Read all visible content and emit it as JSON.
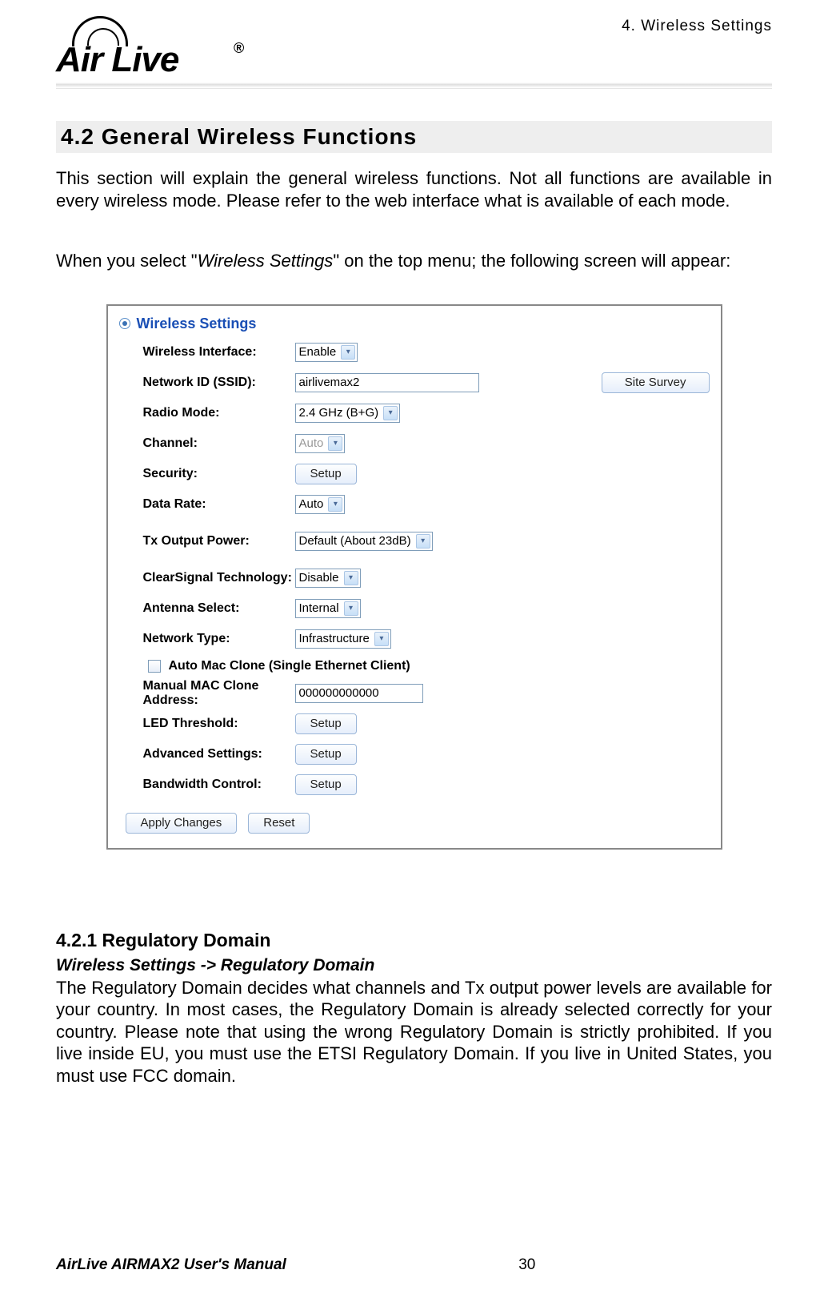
{
  "header": {
    "chapter": "4. Wireless Settings",
    "logo_text": "Air Live",
    "logo_reg": "®"
  },
  "section": {
    "number_title": "4.2 General  Wireless  Functions",
    "para1": "This section will explain the general wireless functions.   Not all functions are available in every wireless mode.    Please refer to the web interface what is available of each mode.",
    "para2_pre": "When you select \"",
    "para2_em": "Wireless Settings",
    "para2_post": "\" on the top menu; the following screen will appear:"
  },
  "panel": {
    "title": "Wireless Settings",
    "rows": {
      "wireless_interface": {
        "label": "Wireless Interface:",
        "value": "Enable"
      },
      "ssid": {
        "label": "Network ID (SSID):",
        "value": "airlivemax2",
        "site_survey": "Site Survey"
      },
      "radio_mode": {
        "label": "Radio Mode:",
        "value": "2.4 GHz (B+G)"
      },
      "channel": {
        "label": "Channel:",
        "value": "Auto"
      },
      "security": {
        "label": "Security:",
        "button": "Setup"
      },
      "data_rate": {
        "label": "Data Rate:",
        "value": "Auto"
      },
      "tx_power": {
        "label": "Tx Output Power:",
        "value": "Default (About 23dB)"
      },
      "clearsignal": {
        "label": "ClearSignal Technology:",
        "value": "Disable"
      },
      "antenna": {
        "label": "Antenna Select:",
        "value": "Internal"
      },
      "network_type": {
        "label": "Network Type:",
        "value": "Infrastructure"
      },
      "auto_mac_clone": "Auto Mac Clone (Single Ethernet Client)",
      "manual_mac": {
        "label": "Manual MAC Clone Address:",
        "value": "000000000000"
      },
      "led_threshold": {
        "label": "LED Threshold:",
        "button": "Setup"
      },
      "advanced": {
        "label": "Advanced Settings:",
        "button": "Setup"
      },
      "bandwidth": {
        "label": "Bandwidth Control:",
        "button": "Setup"
      }
    },
    "buttons": {
      "apply": "Apply Changes",
      "reset": "Reset"
    }
  },
  "subsection": {
    "title": "4.2.1 Regulatory Domain",
    "path": "Wireless Settings -> Regulatory Domain",
    "body": "The Regulatory Domain decides what channels and Tx output power levels are available for your country.   In most cases, the Regulatory Domain is already selected correctly for your country.   Please note that using the wrong Regulatory Domain is strictly prohibited.  If you live inside EU, you must use the ETSI Regulatory Domain.   If you live in United States, you must use FCC domain."
  },
  "footer": {
    "left": "AirLive AIRMAX2 User's Manual",
    "page": "30"
  }
}
